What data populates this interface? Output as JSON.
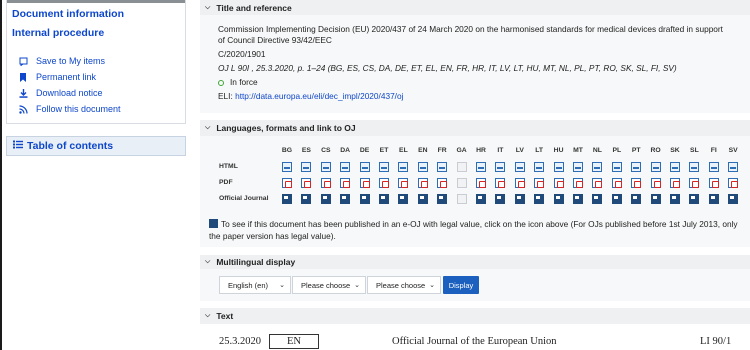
{
  "sidebar": {
    "links": [
      "Document information",
      "Internal procedure"
    ],
    "actions": [
      {
        "label": "Save to My items",
        "icon": "bookmark-outline-icon"
      },
      {
        "label": "Permanent link",
        "icon": "bookmark-filled-icon"
      },
      {
        "label": "Download notice",
        "icon": "download-icon"
      },
      {
        "label": "Follow this document",
        "icon": "rss-icon"
      }
    ],
    "toc_label": "Table of contents"
  },
  "title_section": {
    "heading": "Title and reference",
    "title_line1": "Commission Implementing Decision (EU) 2020/437 of 24 March 2020 on the harmonised standards for medical devices drafted in support",
    "title_line2": "of Council Directive 93/42/EEC",
    "ref": "C/2020/1901",
    "oj_ref": "OJ L 90I , 25.3.2020, p. 1–24 (BG, ES, CS, DA, DE, ET, EL, EN, FR, HR, IT, LV, LT, HU, MT, NL, PL, PT, RO, SK, SL, FI, SV)",
    "status": "In force",
    "eli_label": "ELI: ",
    "eli_url": "http://data.europa.eu/eli/dec_impl/2020/437/oj"
  },
  "languages_section": {
    "heading": "Languages, formats and link to OJ",
    "languages": [
      "BG",
      "ES",
      "CS",
      "DA",
      "DE",
      "ET",
      "EL",
      "EN",
      "FR",
      "GA",
      "HR",
      "IT",
      "LV",
      "LT",
      "HU",
      "MT",
      "NL",
      "PL",
      "PT",
      "RO",
      "SK",
      "SL",
      "FI",
      "SV"
    ],
    "rows": [
      "HTML",
      "PDF",
      "Official Journal"
    ],
    "unavailable_language": "GA",
    "note": "To see if this document has been published in an e-OJ with legal value, click on the icon above (For OJs published before 1st July 2013, only the paper version has legal value)."
  },
  "multilingual_section": {
    "heading": "Multilingual display",
    "select1": "English (en)",
    "select2": "Please choose",
    "select3": "Please choose",
    "button": "Display"
  },
  "text_section": {
    "heading": "Text",
    "date": "25.3.2020",
    "lang_box": "EN",
    "journal": "Official Journal of the European Union",
    "page_ref": "LI 90/1"
  }
}
